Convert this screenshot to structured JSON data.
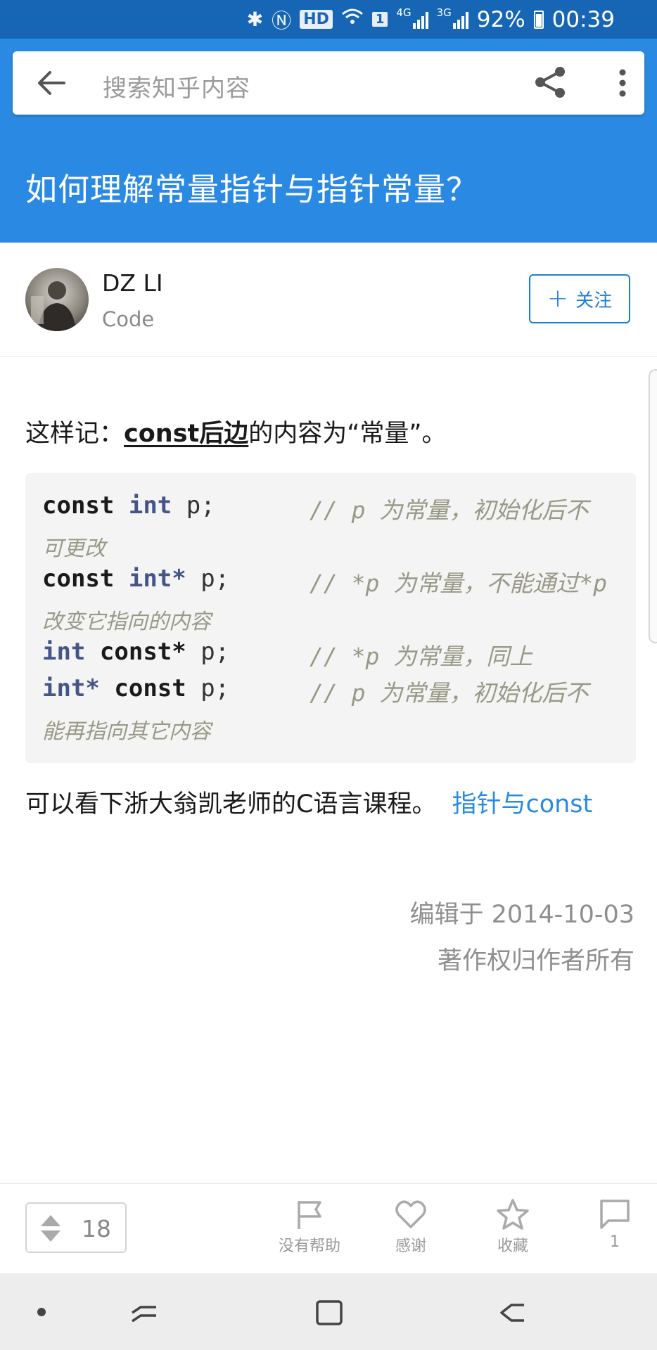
{
  "status_bar": {
    "network_4g": "4G",
    "network_3g": "3G",
    "hd_label": "HD",
    "sim_label": "1",
    "battery": "92%",
    "time": "00:39",
    "icons": [
      "bluetooth-icon",
      "nfc-icon",
      "hd-icon",
      "wifi-icon",
      "sim-icon",
      "signal-icon",
      "signal-icon",
      "battery-icon"
    ]
  },
  "search": {
    "placeholder": "搜索知乎内容"
  },
  "question": {
    "title": "如何理解常量指针与指针常量？"
  },
  "author": {
    "name": "DZ LI",
    "bio": "Code",
    "follow_label": "关注"
  },
  "content": {
    "p1_prefix": "这样记：",
    "p1_emphasis": "const后边",
    "p1_suffix": "的内容为“常量”。",
    "code_lines": [
      {
        "kw1": "const",
        "kw2": "int",
        "rest": " p;",
        "comment": "// p  为常量，初始化后不",
        "wrap": "可更改"
      },
      {
        "kw1": "const",
        "kw2": "int*",
        "rest": " p;",
        "comment": "// *p 为常量，不能通过*p",
        "wrap": "改变它指向的内容"
      },
      {
        "kw1": "int",
        "kw2": "const*",
        "rest": " p;",
        "comment": "// *p 为常量，同上",
        "wrap": ""
      },
      {
        "kw1": "int*",
        "kw2": "const",
        "rest": " p;",
        "comment": "// p  为常量，初始化后不",
        "wrap": "能再指向其它内容"
      }
    ],
    "p2_text": "可以看下浙大翁凯老师的C语言课程。",
    "p2_link": "指针与const",
    "edited": "编辑于 2014-10-03",
    "copyright": "著作权归作者所有"
  },
  "actions": {
    "vote_count": "18",
    "not_helpful": "没有帮助",
    "thanks": "感谢",
    "collect": "收藏",
    "comments_count": "1"
  }
}
